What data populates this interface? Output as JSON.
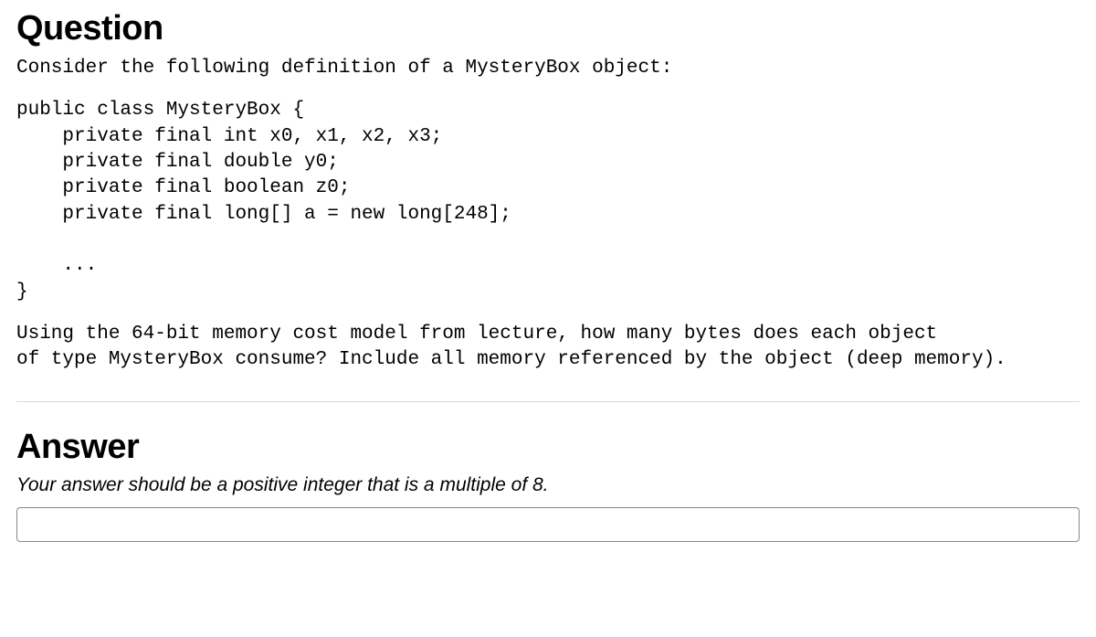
{
  "question": {
    "heading": "Question",
    "intro": "Consider the following definition of a MysteryBox object:",
    "code": "public class MysteryBox {\n    private final int x0, x1, x2, x3;\n    private final double y0;\n    private final boolean z0;\n    private final long[] a = new long[248];\n\n    ...\n}",
    "prompt": "Using the 64-bit memory cost model from lecture, how many bytes does each object\nof type MysteryBox consume? Include all memory referenced by the object (deep memory)."
  },
  "answer": {
    "heading": "Answer",
    "hint": "Your answer should be a positive integer that is a multiple of 8.",
    "value": ""
  }
}
